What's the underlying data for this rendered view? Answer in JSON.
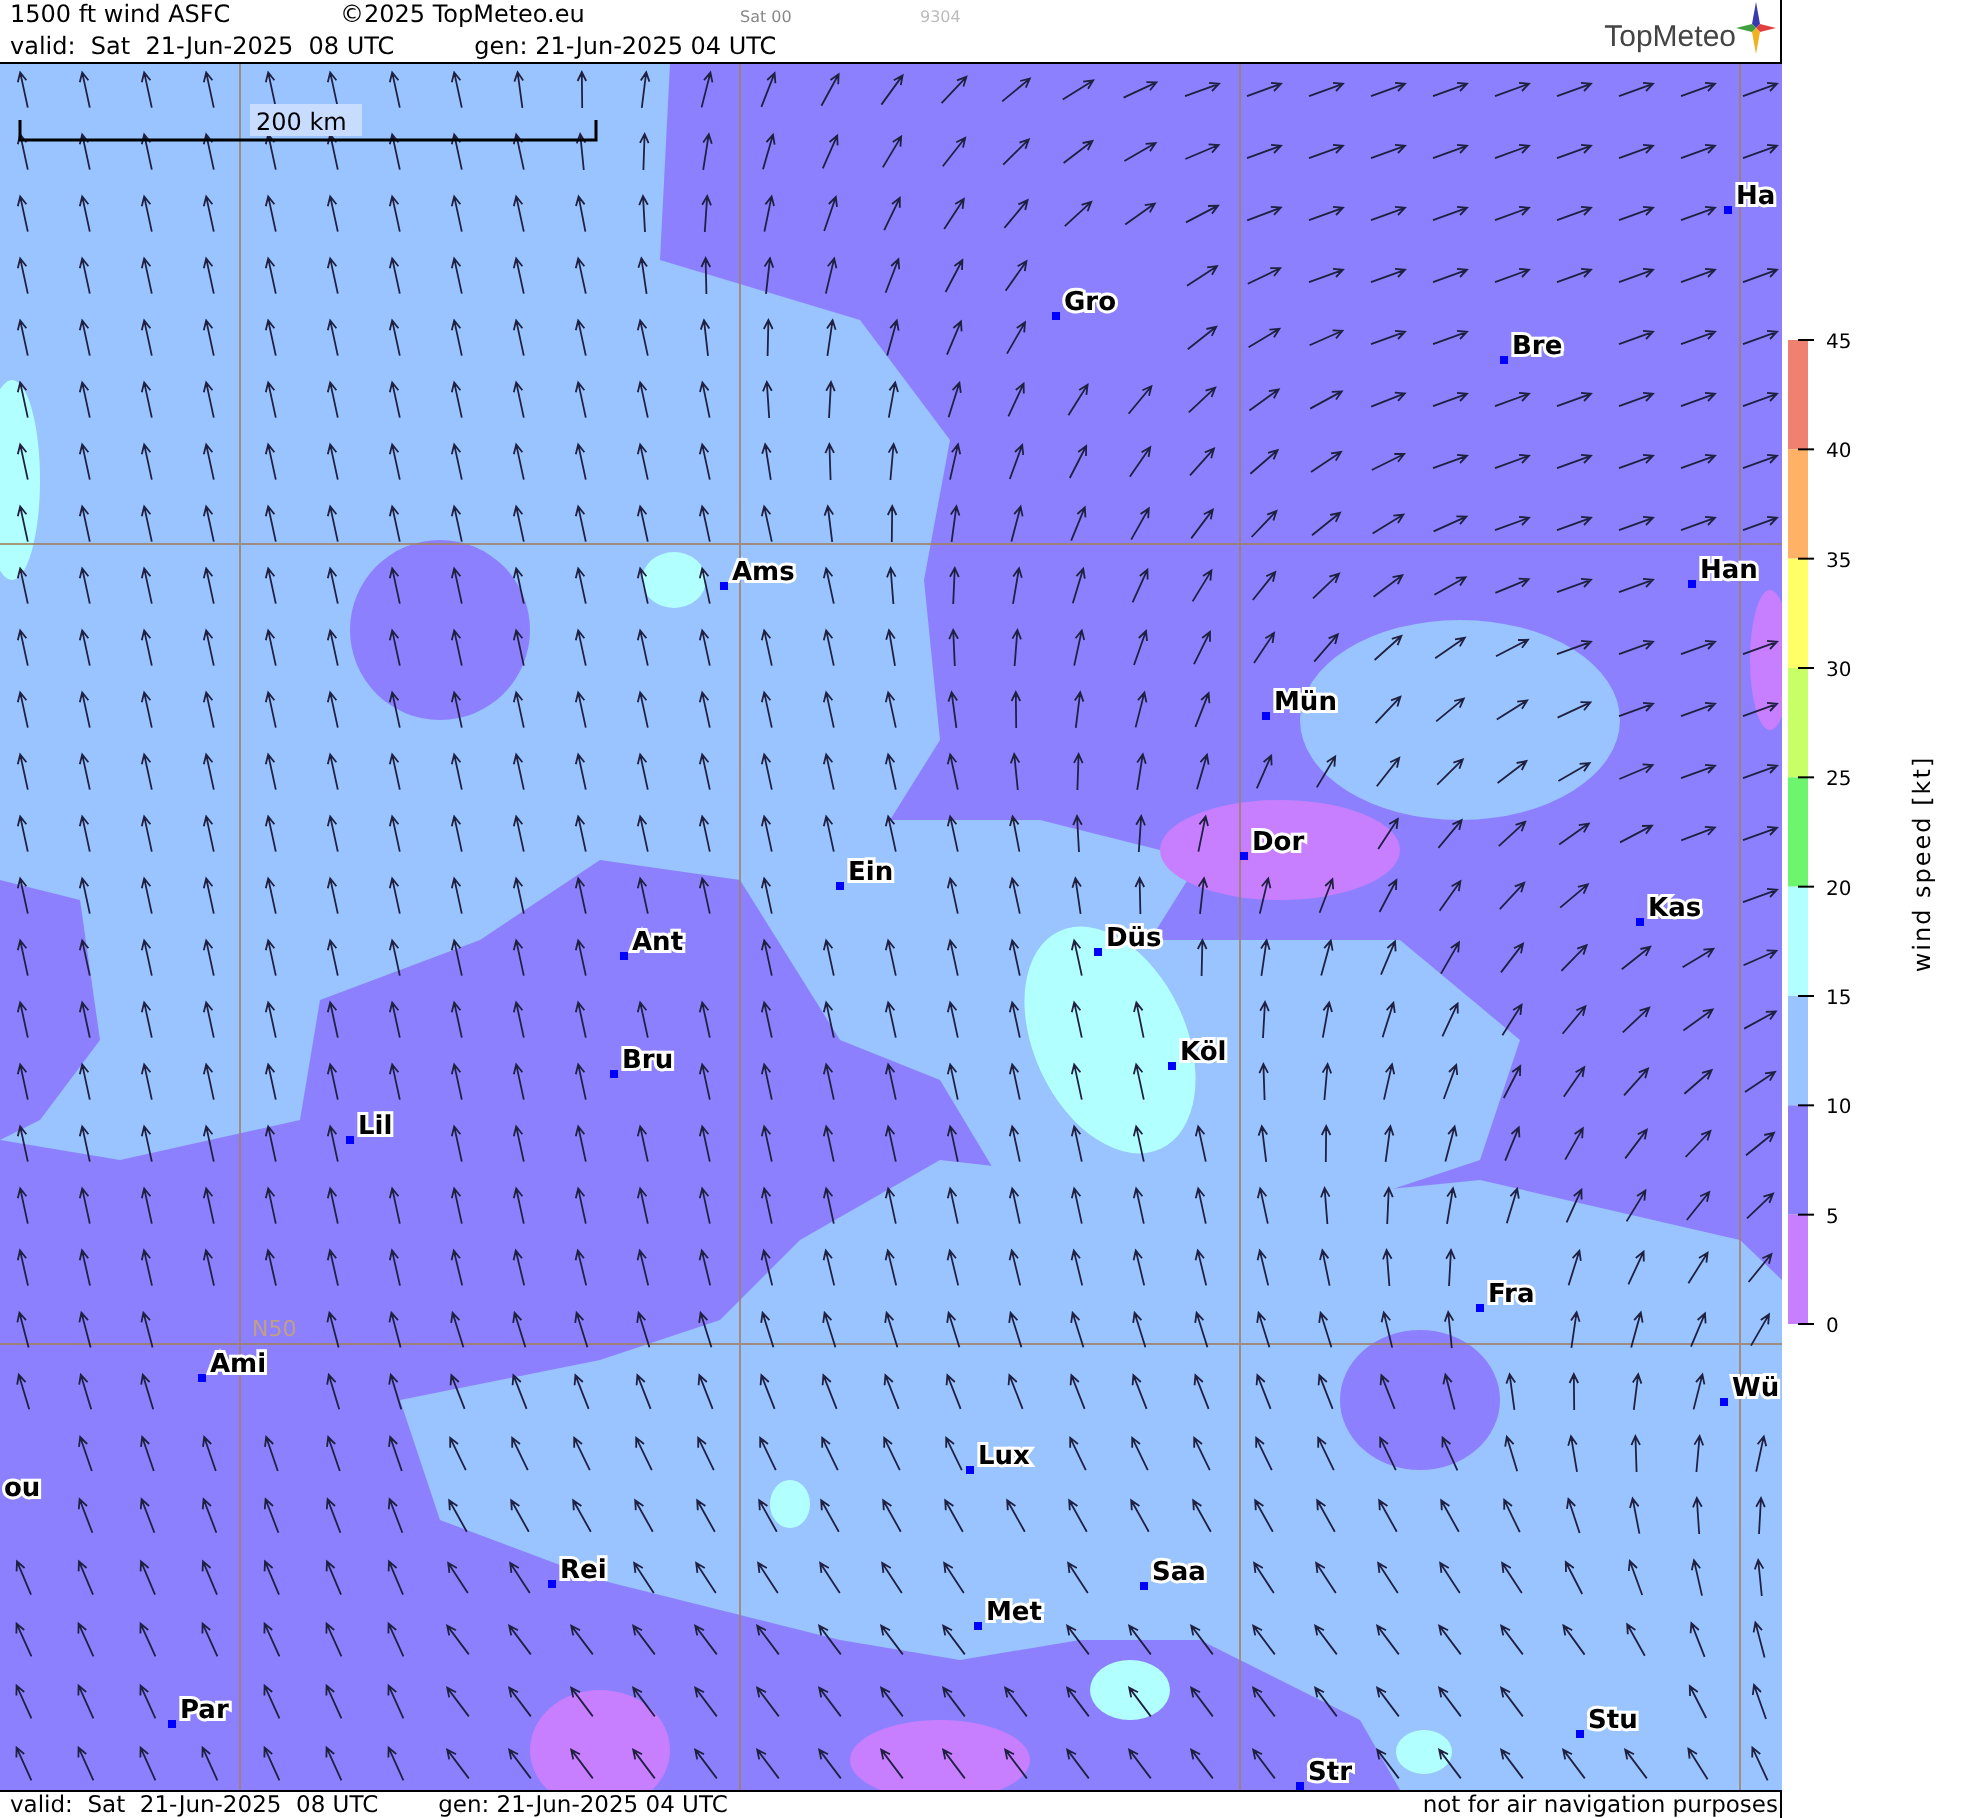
{
  "header": {
    "title": "1500 ft wind ASFC",
    "copyright": "©2025 TopMeteo.eu",
    "run": "Sat 00",
    "code": "9304",
    "valid": "valid:  Sat  21-Jun-2025  08 UTC",
    "generated": "gen: 21-Jun-2025 04 UTC",
    "logo": "TopMeteo"
  },
  "map": {
    "scale": "200 km",
    "latitude": "N50",
    "cities": [
      {
        "name": "Ha"
      },
      {
        "name": "Gro"
      },
      {
        "name": "Bre"
      },
      {
        "name": "Ams"
      },
      {
        "name": "Han"
      },
      {
        "name": "Mün"
      },
      {
        "name": "Dor"
      },
      {
        "name": "Ein"
      },
      {
        "name": "Kas"
      },
      {
        "name": "Ant"
      },
      {
        "name": "Düs"
      },
      {
        "name": "Köl"
      },
      {
        "name": "Bru"
      },
      {
        "name": "Lil"
      },
      {
        "name": "Fra"
      },
      {
        "name": "Ami"
      },
      {
        "name": "Wü"
      },
      {
        "name": "ou"
      },
      {
        "name": "Lux"
      },
      {
        "name": "Rei"
      },
      {
        "name": "Saa"
      },
      {
        "name": "Met"
      },
      {
        "name": "Par"
      },
      {
        "name": "Stu"
      },
      {
        "name": "Str"
      }
    ]
  },
  "legend": {
    "title": "wind speed [kt]",
    "ticks": [
      "45",
      "40",
      "35",
      "30",
      "25",
      "20",
      "15",
      "10",
      "5",
      "0"
    ],
    "bands": [
      {
        "color": "#f08070"
      },
      {
        "color": "#ffb266"
      },
      {
        "color": "#ffff66"
      },
      {
        "color": "#c8ff66"
      },
      {
        "color": "#6ef56e"
      },
      {
        "color": "#b2ffff"
      },
      {
        "color": "#99c4ff"
      },
      {
        "color": "#8c80ff"
      },
      {
        "color": "#c77fff"
      }
    ]
  },
  "footer": {
    "valid": "valid:  Sat  21-Jun-2025  08 UTC",
    "generated": "gen: 21-Jun-2025 04 UTC",
    "disclaimer": "not for air navigation purposes"
  }
}
